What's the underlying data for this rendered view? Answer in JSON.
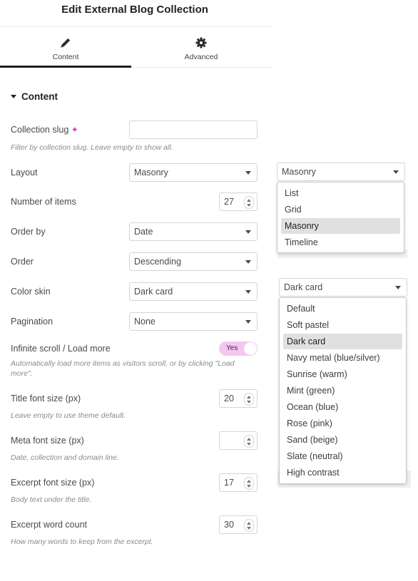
{
  "header": {
    "title": "Edit External Blog Collection"
  },
  "tabs": [
    {
      "label": "Content",
      "icon": "pencil-icon",
      "active": true
    },
    {
      "label": "Advanced",
      "icon": "gear-icon",
      "active": false
    }
  ],
  "section": {
    "title": "Content"
  },
  "fields": {
    "collection_slug": {
      "label": "Collection slug",
      "value": "",
      "description": "Filter by collection slug. Leave empty to show all."
    },
    "layout": {
      "label": "Layout",
      "value": "Masonry"
    },
    "items": {
      "label": "Number of items",
      "value": "27"
    },
    "order_by": {
      "label": "Order by",
      "value": "Date"
    },
    "order": {
      "label": "Order",
      "value": "Descending"
    },
    "color_skin": {
      "label": "Color skin",
      "value": "Dark card"
    },
    "pagination": {
      "label": "Pagination",
      "value": "None"
    },
    "infinite": {
      "label": "Infinite scroll / Load more",
      "value": "Yes",
      "description_1": "Automatically load more items as visitors scroll, or by clicking \"Load",
      "description_2": "more\"."
    },
    "title_size": {
      "label": "Title font size (px)",
      "value": "20",
      "description": "Leave empty to use theme default."
    },
    "meta_size": {
      "label": "Meta font size (px)",
      "value": "",
      "description": "Date, collection and domain line."
    },
    "excerpt_size": {
      "label": "Excerpt font size (px)",
      "value": "17",
      "description": "Body text under the title."
    },
    "word_count": {
      "label": "Excerpt word count",
      "value": "30",
      "description": "How many words to keep from the excerpt."
    }
  },
  "layout_dropdown": {
    "value": "Masonry",
    "options": [
      "List",
      "Grid",
      "Masonry",
      "Timeline"
    ],
    "selected": "Masonry"
  },
  "skin_dropdown": {
    "value": "Dark card",
    "options": [
      "Default",
      "Soft pastel",
      "Dark card",
      "Navy metal (blue/silver)",
      "Sunrise (warm)",
      "Mint (green)",
      "Ocean (blue)",
      "Rose (pink)",
      "Sand (beige)",
      "Slate (neutral)",
      "High contrast"
    ],
    "selected": "Dark card"
  },
  "colors": {
    "accent": "#d63cc7",
    "toggle_bg": "#f3c7ef",
    "selected_option": "#e0e0e0"
  }
}
